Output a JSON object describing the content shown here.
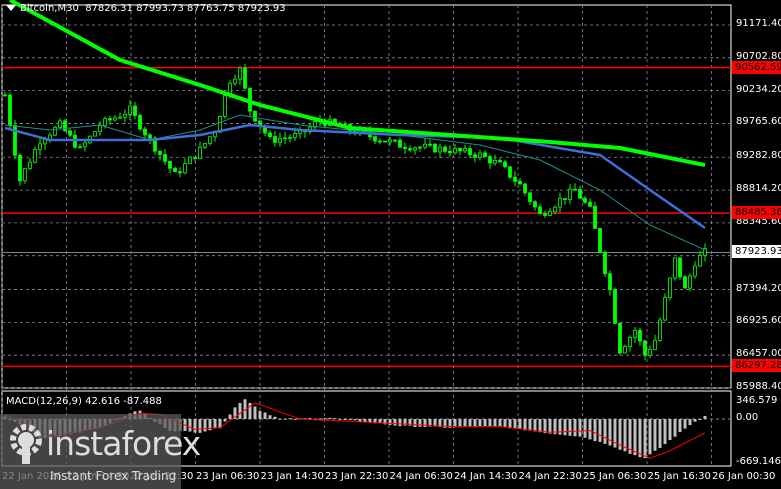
{
  "header": {
    "symbol": "Bitcoin,M30",
    "open": "87826.31",
    "high": "87993.73",
    "low": "87763.75",
    "close": "87923.93"
  },
  "macd": {
    "label": "MACD(12,26,9) 42.616 -87.488",
    "axis": [
      "346.579",
      "0.00",
      "-669.146"
    ],
    "max": 346.579,
    "min": -669.146
  },
  "price_axis": [
    "91171.40",
    "90702.80",
    "90234.20",
    "89765.60",
    "89282.80",
    "88814.20",
    "88345.60",
    "87394.20",
    "86925.60",
    "86457.00",
    "85988.40"
  ],
  "price_range": [
    85988.4,
    91171.4
  ],
  "levels": [
    {
      "label": "90562.59",
      "value": 90562.59
    },
    {
      "label": "88485.36",
      "value": 88485.36
    },
    {
      "label": "86297.28",
      "value": 86297.28
    }
  ],
  "current_price": {
    "label": "87923.93",
    "value": 87923.93
  },
  "time_axis": [
    "22 Jan 2026",
    "22 Jan 14:30",
    "22 Jan 22:30",
    "23 Jan 06:30",
    "23 Jan 14:30",
    "23 Jan 22:30",
    "24 Jan 06:30",
    "24 Jan 14:30",
    "24 Jan 22:30",
    "25 Jan 06:30",
    "25 Jan 16:30",
    "26 Jan 00:30"
  ],
  "watermark": {
    "brand": "instaforex",
    "tagline": "Instant Forex Trading"
  },
  "colors": {
    "candle": "#00ff00",
    "ma_slow": "#00ff00",
    "ma_mid": "#3d6fd6",
    "ma_fast": "#1f8f8f",
    "level": "#ff0000",
    "macd_hist": "#c0c0c0",
    "macd_signal": "#ff0000"
  },
  "chart_data": {
    "type": "candlestick",
    "bars": 140,
    "price_anchors": [
      [
        0,
        90172
      ],
      [
        3,
        88958
      ],
      [
        7,
        89529
      ],
      [
        11,
        89744
      ],
      [
        15,
        89387
      ],
      [
        19,
        89744
      ],
      [
        25,
        89958
      ],
      [
        29,
        89529
      ],
      [
        34,
        89030
      ],
      [
        39,
        89387
      ],
      [
        42,
        89672
      ],
      [
        45,
        90386
      ],
      [
        47,
        90529
      ],
      [
        49,
        89958
      ],
      [
        53,
        89529
      ],
      [
        59,
        89601
      ],
      [
        63,
        89815
      ],
      [
        69,
        89672
      ],
      [
        79,
        89458
      ],
      [
        89,
        89387
      ],
      [
        95,
        89315
      ],
      [
        99,
        89172
      ],
      [
        103,
        88887
      ],
      [
        107,
        88459
      ],
      [
        111,
        88673
      ],
      [
        114,
        88815
      ],
      [
        117,
        88530
      ],
      [
        119,
        87959
      ],
      [
        121,
        87388
      ],
      [
        123,
        86532
      ],
      [
        126,
        86817
      ],
      [
        128,
        86460
      ],
      [
        130,
        86674
      ],
      [
        132,
        87245
      ],
      [
        134,
        87816
      ],
      [
        136,
        87388
      ],
      [
        138,
        87787
      ],
      [
        140,
        87924
      ]
    ],
    "ma_slow": [
      [
        1,
        91528
      ],
      [
        23,
        90672
      ],
      [
        39,
        90315
      ],
      [
        51,
        90029
      ],
      [
        69,
        89701
      ],
      [
        89,
        89601
      ],
      [
        109,
        89501
      ],
      [
        123,
        89415
      ],
      [
        140,
        89172
      ]
    ],
    "ma_mid": [
      [
        0,
        89701
      ],
      [
        9,
        89529
      ],
      [
        29,
        89529
      ],
      [
        39,
        89601
      ],
      [
        49,
        89744
      ],
      [
        59,
        89672
      ],
      [
        79,
        89601
      ],
      [
        99,
        89558
      ],
      [
        119,
        89315
      ],
      [
        129,
        88815
      ],
      [
        140,
        88273
      ]
    ],
    "ma_fast": [
      [
        0,
        89744
      ],
      [
        9,
        89672
      ],
      [
        19,
        89744
      ],
      [
        29,
        89529
      ],
      [
        39,
        89672
      ],
      [
        47,
        89886
      ],
      [
        59,
        89744
      ],
      [
        79,
        89601
      ],
      [
        95,
        89458
      ],
      [
        107,
        89244
      ],
      [
        119,
        88815
      ],
      [
        129,
        88316
      ],
      [
        140,
        87959
      ]
    ],
    "macd_hist": [
      [
        0,
        50
      ],
      [
        3,
        -100
      ],
      [
        7,
        -350
      ],
      [
        11,
        -300
      ],
      [
        19,
        -150
      ],
      [
        25,
        100
      ],
      [
        27,
        150
      ],
      [
        30,
        -50
      ],
      [
        33,
        -200
      ],
      [
        39,
        -230
      ],
      [
        43,
        -150
      ],
      [
        46,
        200
      ],
      [
        48,
        350
      ],
      [
        51,
        150
      ],
      [
        55,
        0
      ],
      [
        65,
        20
      ],
      [
        79,
        -120
      ],
      [
        89,
        -150
      ],
      [
        99,
        -130
      ],
      [
        109,
        -250
      ],
      [
        115,
        -300
      ],
      [
        121,
        -450
      ],
      [
        125,
        -600
      ],
      [
        128,
        -680
      ],
      [
        131,
        -500
      ],
      [
        137,
        -100
      ],
      [
        140,
        60
      ]
    ],
    "macd_signal": [
      [
        0,
        80
      ],
      [
        9,
        -300
      ],
      [
        19,
        -150
      ],
      [
        27,
        100
      ],
      [
        31,
        80
      ],
      [
        38,
        -180
      ],
      [
        43,
        -150
      ],
      [
        50,
        280
      ],
      [
        59,
        0
      ],
      [
        69,
        -40
      ],
      [
        89,
        -130
      ],
      [
        99,
        -130
      ],
      [
        109,
        -230
      ],
      [
        117,
        -200
      ],
      [
        123,
        -450
      ],
      [
        129,
        -680
      ],
      [
        133,
        -550
      ],
      [
        140,
        -240
      ]
    ]
  }
}
